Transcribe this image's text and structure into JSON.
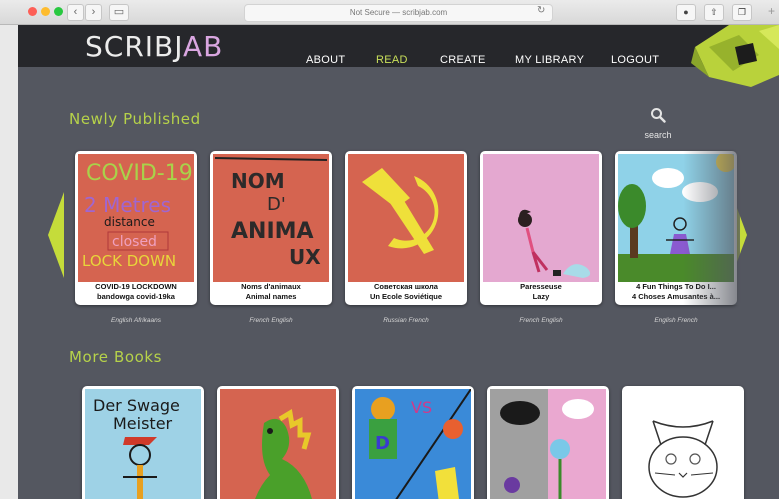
{
  "browser": {
    "address": "Not Secure — scribjab.com",
    "back_icon": "chevron-left-icon",
    "forward_icon": "chevron-right-icon",
    "sidebar_icon": "sidebar-icon",
    "reload_icon": "reload-icon",
    "download_icon": "download-icon",
    "share_icon": "share-icon",
    "tabs_icon": "tabs-icon",
    "new_tab_icon": "plus-icon"
  },
  "site": {
    "logo_main": "SCRIBJ",
    "logo_accent": "AB",
    "nav": [
      "ABOUT",
      "READ",
      "CREATE",
      "MY LIBRARY",
      "LOGOUT"
    ],
    "active_nav": "READ"
  },
  "search": {
    "label": "search"
  },
  "sections": {
    "newly_published": "Newly Published",
    "more_books": "More Books"
  },
  "newly_published": [
    {
      "title1": "COVID-19 LOCKDOWN",
      "title2": "bandowga covid-19ka",
      "lang": "English  Afrikaans",
      "cover_text": [
        "COVID-19",
        "2 Metres",
        "distance",
        "closed",
        "LOCK DOWN"
      ]
    },
    {
      "title1": "Noms d'animaux",
      "title2": "Animal names",
      "lang": "French  English",
      "cover_text": [
        "NOM",
        "D'",
        "ANIMA",
        "UX"
      ]
    },
    {
      "title1": "Советская школа",
      "title2": "Un Ecole Soviétique",
      "lang": "Russian  French"
    },
    {
      "title1": "Paresseuse",
      "title2": "Lazy",
      "lang": "French  English"
    },
    {
      "title1": "4 Fun Things To Do I...",
      "title2": "4 Choses Amusantes à...",
      "lang": "English  French"
    }
  ],
  "more_books": [
    {
      "cover_text": [
        "Der Swage",
        "Meister"
      ]
    },
    {
      "cover_text": []
    },
    {
      "cover_text": [
        "VS"
      ]
    },
    {
      "cover_text": []
    },
    {
      "cover_text": []
    }
  ],
  "colors": {
    "page_bg": "#545760",
    "topbar_bg": "#26272b",
    "accent_green": "#b6d24a",
    "active_nav": "#c9e05a"
  }
}
